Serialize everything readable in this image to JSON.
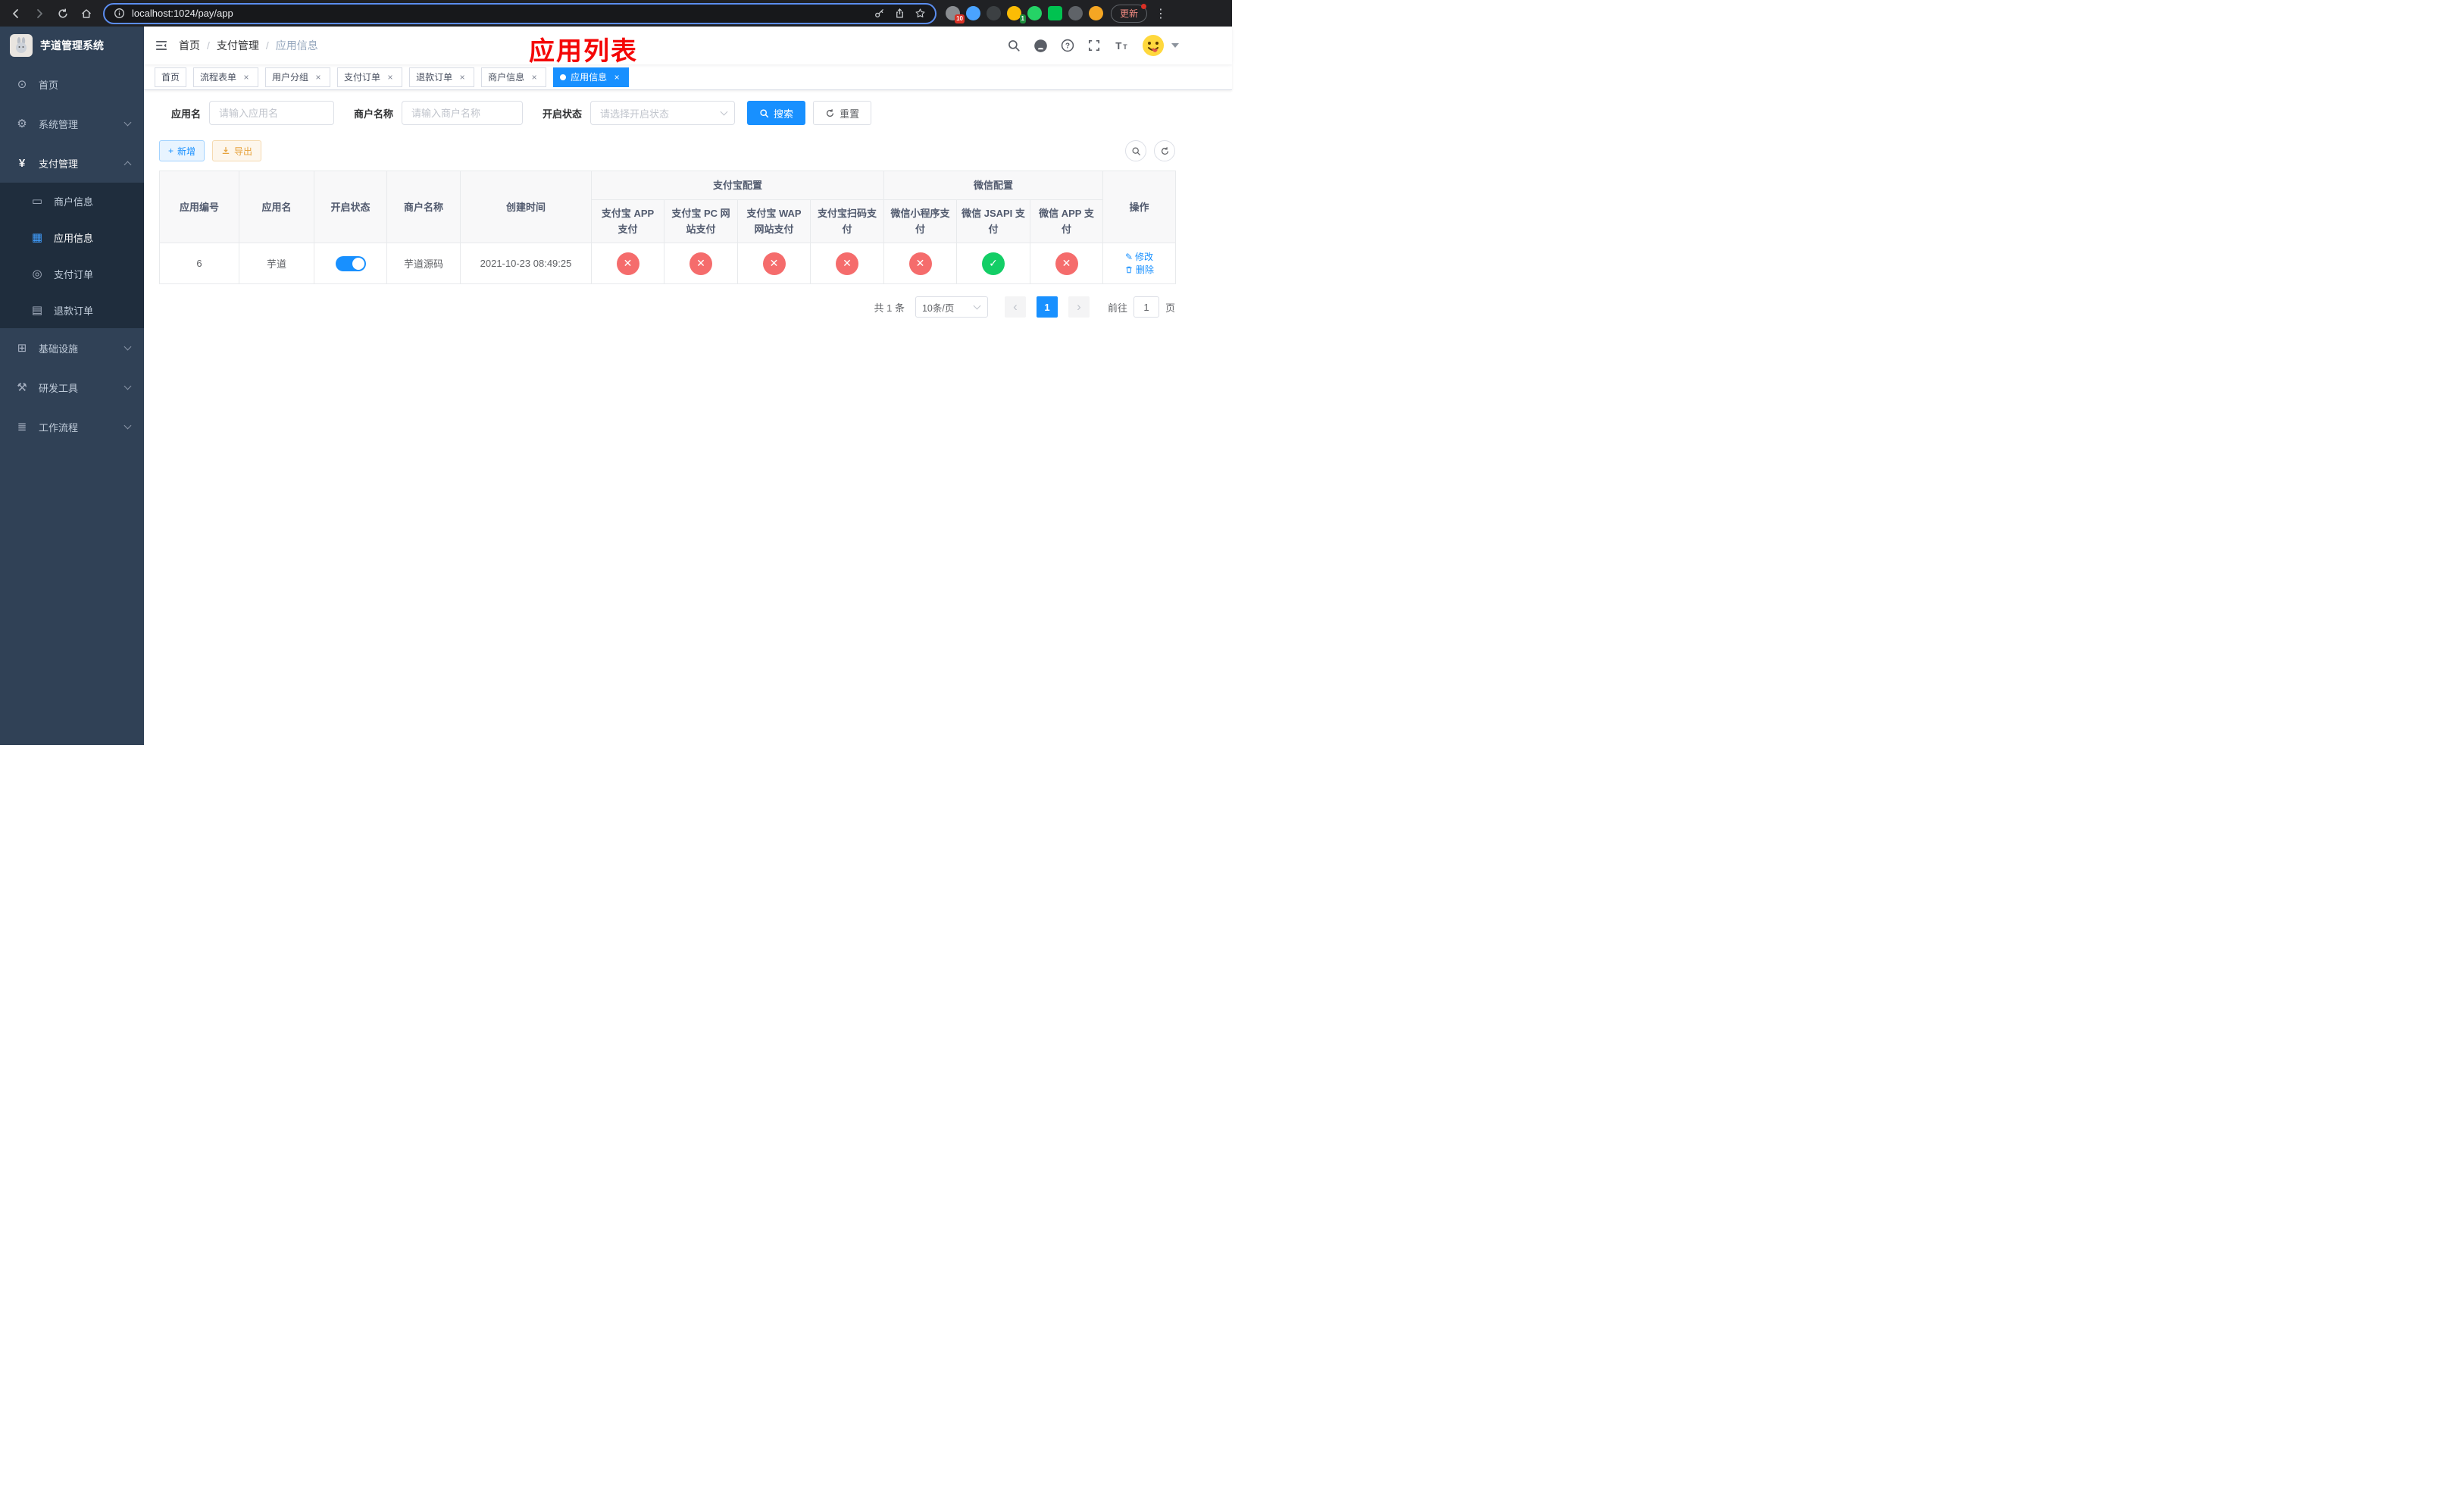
{
  "icons": {
    "menu_home": "⊙",
    "menu_system": "⚙",
    "menu_payment": "¥",
    "menu_merchant": "▭",
    "menu_app": "▦",
    "menu_pay_order": "◎",
    "menu_refund_order": "▤",
    "menu_infra": "⊞",
    "menu_devtools": "⚒",
    "menu_workflow": "≣",
    "check": "✓",
    "cross": "✕",
    "close": "×",
    "plus": "+",
    "edit": "✎",
    "sep": "/",
    "prev": "‹",
    "next": "›",
    "more": "⋮"
  },
  "browser": {
    "url": "localhost:1024/pay/app",
    "update_label": "更新",
    "extension_badges": {
      "puzzle": "10",
      "translate": "1"
    }
  },
  "sidebar": {
    "title": "芋道管理系统",
    "items": {
      "home": "首页",
      "system": "系统管理",
      "payment": "支付管理",
      "merchant": "商户信息",
      "app": "应用信息",
      "pay_order": "支付订单",
      "refund_order": "退款订单",
      "infra": "基础设施",
      "devtools": "研发工具",
      "workflow": "工作流程"
    }
  },
  "navbar": {
    "breadcrumb": {
      "home": "首页",
      "payment": "支付管理",
      "current": "应用信息"
    },
    "annotation": "应用列表"
  },
  "tabs": [
    {
      "label": "首页",
      "closable": false,
      "active": false
    },
    {
      "label": "流程表单",
      "closable": true,
      "active": false
    },
    {
      "label": "用户分组",
      "closable": true,
      "active": false
    },
    {
      "label": "支付订单",
      "closable": true,
      "active": false
    },
    {
      "label": "退款订单",
      "closable": true,
      "active": false
    },
    {
      "label": "商户信息",
      "closable": true,
      "active": false
    },
    {
      "label": "应用信息",
      "closable": true,
      "active": true
    }
  ],
  "filters": {
    "app_name": {
      "label": "应用名",
      "placeholder": "请输入应用名",
      "value": ""
    },
    "merchant_name": {
      "label": "商户名称",
      "placeholder": "请输入商户名称",
      "value": ""
    },
    "status": {
      "label": "开启状态",
      "placeholder": "请选择开启状态",
      "value": ""
    },
    "search_label": "搜索",
    "reset_label": "重置"
  },
  "toolbar": {
    "add_label": "新增",
    "export_label": "导出"
  },
  "table": {
    "groups": {
      "alipay": "支付宝配置",
      "wechat": "微信配置"
    },
    "columns": {
      "id": "应用编号",
      "name": "应用名",
      "status": "开启状态",
      "merchant": "商户名称",
      "created": "创建时间",
      "alipay_app": "支付宝 APP 支付",
      "alipay_pc": "支付宝 PC 网站支付",
      "alipay_wap": "支付宝 WAP 网站支付",
      "alipay_qr": "支付宝扫码支付",
      "wx_mini": "微信小程序支付",
      "wx_jsapi": "微信 JSAPI 支付",
      "wx_app": "微信 APP 支付",
      "ops": "操作"
    },
    "rows": [
      {
        "id": "6",
        "name": "芋道",
        "status_on": true,
        "merchant": "芋道源码",
        "created": "2021-10-23 08:49:25",
        "configs": [
          "no",
          "no",
          "no",
          "no",
          "no",
          "yes",
          "no"
        ],
        "edit_label": "修改",
        "delete_label": "删除"
      }
    ]
  },
  "pagination": {
    "total": "共 1 条",
    "page_size": "10条/页",
    "page": "1",
    "goto_prefix": "前往",
    "goto_value": "1",
    "goto_suffix": "页"
  },
  "colors": {
    "primary": "#1890ff",
    "success": "#13ce66",
    "danger": "#f56c6c",
    "warning": "#e6a23c",
    "annotation": "#f40606",
    "sidebar_bg": "#304156",
    "submenu_bg": "#1f2d3d"
  }
}
